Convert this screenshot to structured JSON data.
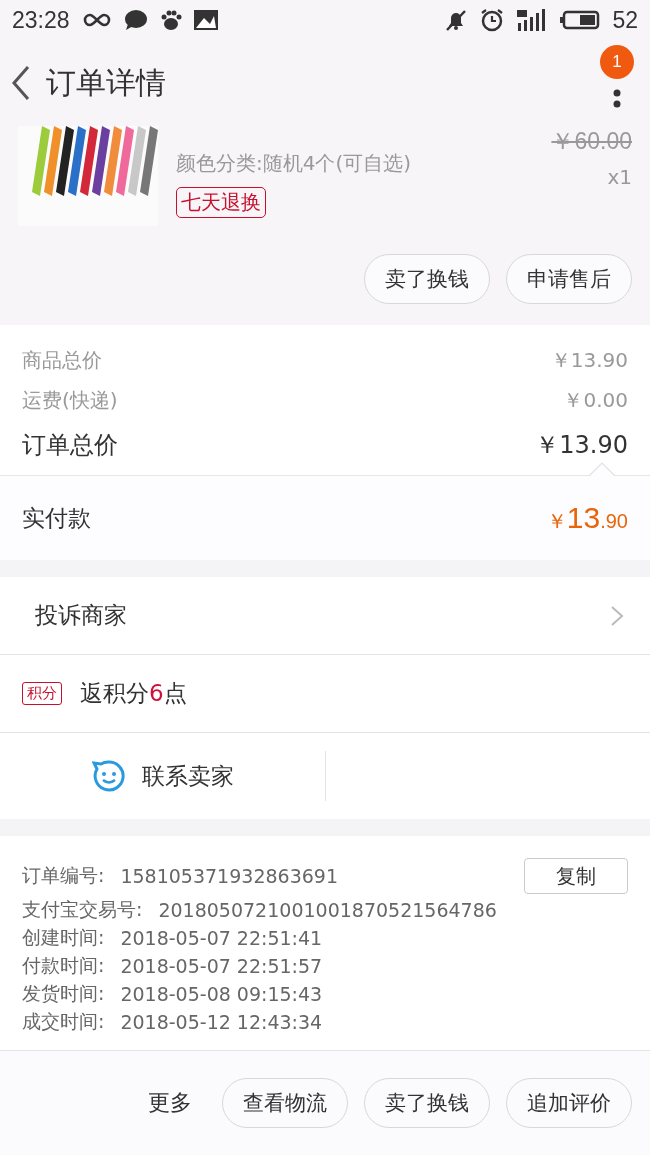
{
  "status_bar": {
    "time": "23:28",
    "battery": "52"
  },
  "header": {
    "title": "订单详情",
    "badge": "1"
  },
  "product": {
    "image": {
      "kind": "picture"
    },
    "variant": "颜色分类:随机4个(可自选)",
    "original_price": "￥60.00",
    "quantity": "x1",
    "tag": "七天退换",
    "actions": [
      "卖了换钱",
      "申请售后"
    ]
  },
  "price_summary": [
    {
      "label": "商品总价",
      "value": "￥13.90",
      "kind": "minor"
    },
    {
      "label": "运费(快递)",
      "value": "￥0.00",
      "kind": "minor"
    },
    {
      "label": "订单总价",
      "value": "￥13.90",
      "kind": "major"
    }
  ],
  "paid": {
    "label": "实付款",
    "currency": "￥",
    "integer": "13",
    "decimal": ".90"
  },
  "complaint": {
    "label": "投诉商家"
  },
  "points": {
    "badge": "积分",
    "text": "返积分**6**点"
  },
  "contact": {
    "label": "联系卖家"
  },
  "order_info": {
    "copy_button": "复制",
    "rows": [
      {
        "label": "订单编号:",
        "value": "158105371932863691"
      },
      {
        "label": "支付宝交易号:",
        "value": "2018050721001001870521564786"
      },
      {
        "label": "创建时间:",
        "value": "2018-05-07 22:51:41"
      },
      {
        "label": "付款时间:",
        "value": "2018-05-07 22:51:57"
      },
      {
        "label": "发货时间:",
        "value": "2018-05-08 09:15:43"
      },
      {
        "label": "成交时间:",
        "value": "2018-05-12 12:43:34"
      }
    ]
  },
  "bottom_bar": {
    "more": "更多",
    "buttons": [
      "查看物流",
      "卖了换钱",
      "追加评价"
    ]
  }
}
